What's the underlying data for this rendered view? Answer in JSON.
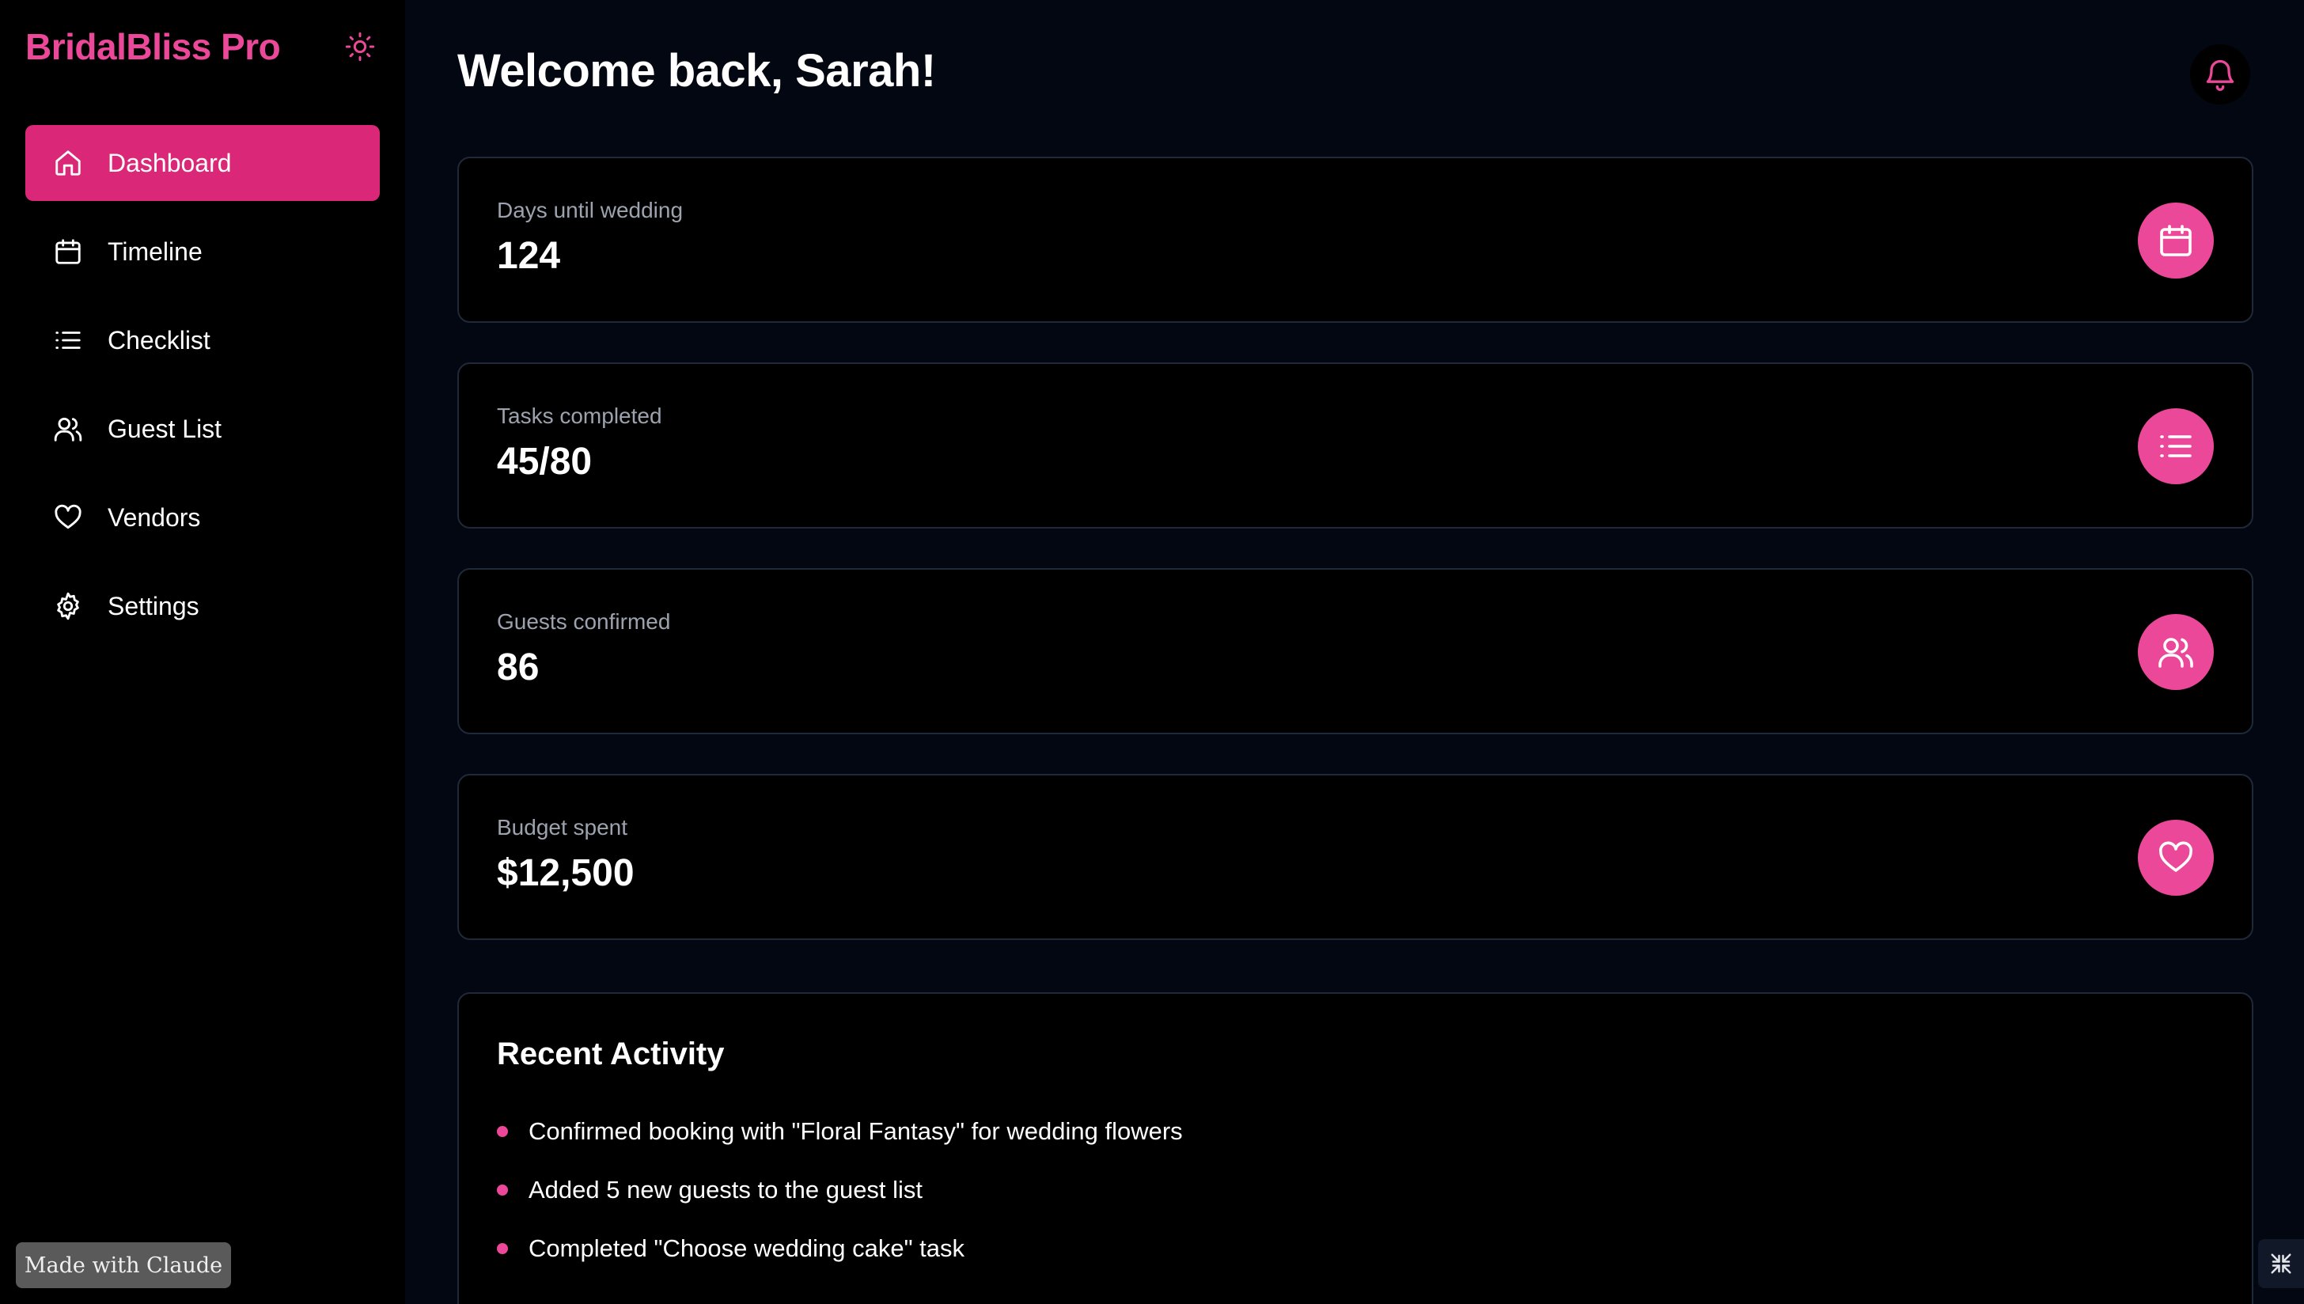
{
  "app": {
    "name": "BridalBliss Pro"
  },
  "colors": {
    "accent": "#ec4899",
    "active_nav": "#db2777",
    "background": "#030712",
    "surface": "#000000"
  },
  "sidebar": {
    "items": [
      {
        "label": "Dashboard",
        "icon": "home-icon",
        "active": true
      },
      {
        "label": "Timeline",
        "icon": "calendar-icon"
      },
      {
        "label": "Checklist",
        "icon": "list-icon"
      },
      {
        "label": "Guest List",
        "icon": "users-icon"
      },
      {
        "label": "Vendors",
        "icon": "heart-icon"
      },
      {
        "label": "Settings",
        "icon": "gear-icon"
      }
    ],
    "theme_toggle_icon": "sun-icon"
  },
  "header": {
    "title": "Welcome back, Sarah!",
    "notification_icon": "bell-icon"
  },
  "stats": [
    {
      "label": "Days until wedding",
      "value": "124",
      "icon": "calendar-icon"
    },
    {
      "label": "Tasks completed",
      "value": "45/80",
      "icon": "list-icon"
    },
    {
      "label": "Guests confirmed",
      "value": "86",
      "icon": "users-icon"
    },
    {
      "label": "Budget spent",
      "value": "$12,500",
      "icon": "heart-icon"
    }
  ],
  "recent_activity": {
    "title": "Recent Activity",
    "items": [
      "Confirmed booking with \"Floral Fantasy\" for wedding flowers",
      "Added 5 new guests to the guest list",
      "Completed \"Choose wedding cake\" task"
    ]
  },
  "footer": {
    "made_with": "Made with Claude",
    "minimize_icon": "minimize-icon"
  }
}
